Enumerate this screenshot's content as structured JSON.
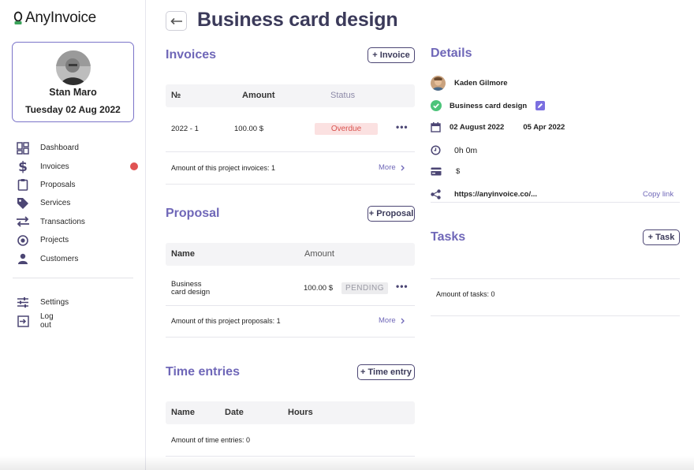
{
  "app": {
    "logo_text": "AnyInvoice"
  },
  "profile": {
    "name": "Stan Maro",
    "date": "Tuesday 02 Aug 2022"
  },
  "sidebar": {
    "items": [
      {
        "label": "Dashboard",
        "icon": "dashboard-icon"
      },
      {
        "label": "Invoices",
        "icon": "dollar-icon",
        "has_alert": true
      },
      {
        "label": "Proposals",
        "icon": "clipboard-icon"
      },
      {
        "label": "Services",
        "icon": "tags-icon"
      },
      {
        "label": "Transactions",
        "icon": "transfer-icon"
      },
      {
        "label": "Projects",
        "icon": "target-icon"
      },
      {
        "label": "Customers",
        "icon": "user-icon"
      }
    ],
    "bottom_items": [
      {
        "label": "Settings",
        "icon": "sliders-icon"
      },
      {
        "label": "Log out",
        "icon": "logout-icon"
      }
    ]
  },
  "header": {
    "title": "Business card design"
  },
  "invoices": {
    "title": "Invoices",
    "add_label": "+ Invoice",
    "columns": {
      "number": "№",
      "amount": "Amount",
      "status": "Status"
    },
    "rows": [
      {
        "number": "2022 - 1",
        "amount": "100.00  $",
        "status": "Overdue"
      }
    ],
    "summary": "Amount of this project invoices: 1",
    "more_label": "More"
  },
  "proposal": {
    "title": "Proposal",
    "add_label": "+ Proposal",
    "columns": {
      "name": "Name",
      "amount": "Amount"
    },
    "rows": [
      {
        "name_line1": "Business",
        "name_line2": "card design",
        "amount": "100.00  $",
        "status": "PENDING"
      }
    ],
    "summary": "Amount of this project proposals: 1",
    "more_label": "More"
  },
  "time_entries": {
    "title": "Time entries",
    "add_label": "+ Time entry",
    "columns": {
      "name": "Name",
      "date": "Date",
      "hours": "Hours"
    },
    "summary": "Amount of time entries: 0"
  },
  "details": {
    "title": "Details",
    "customer": "Kaden Gilmore",
    "project": "Business card design",
    "start_date": "02 August 2022",
    "end_date": "05 Apr 2022",
    "time": "0h 0m",
    "currency": "$",
    "link": "https://anyinvoice.co/...",
    "copy_label": "Copy link"
  },
  "tasks": {
    "title": "Tasks",
    "add_label": "+ Task",
    "summary": "Amount of tasks: 0"
  },
  "colors": {
    "accent": "#6f67b8",
    "title": "#3b3a5a",
    "overdue": "#d9534f",
    "success": "#4cc47a",
    "alert": "#e05353"
  }
}
